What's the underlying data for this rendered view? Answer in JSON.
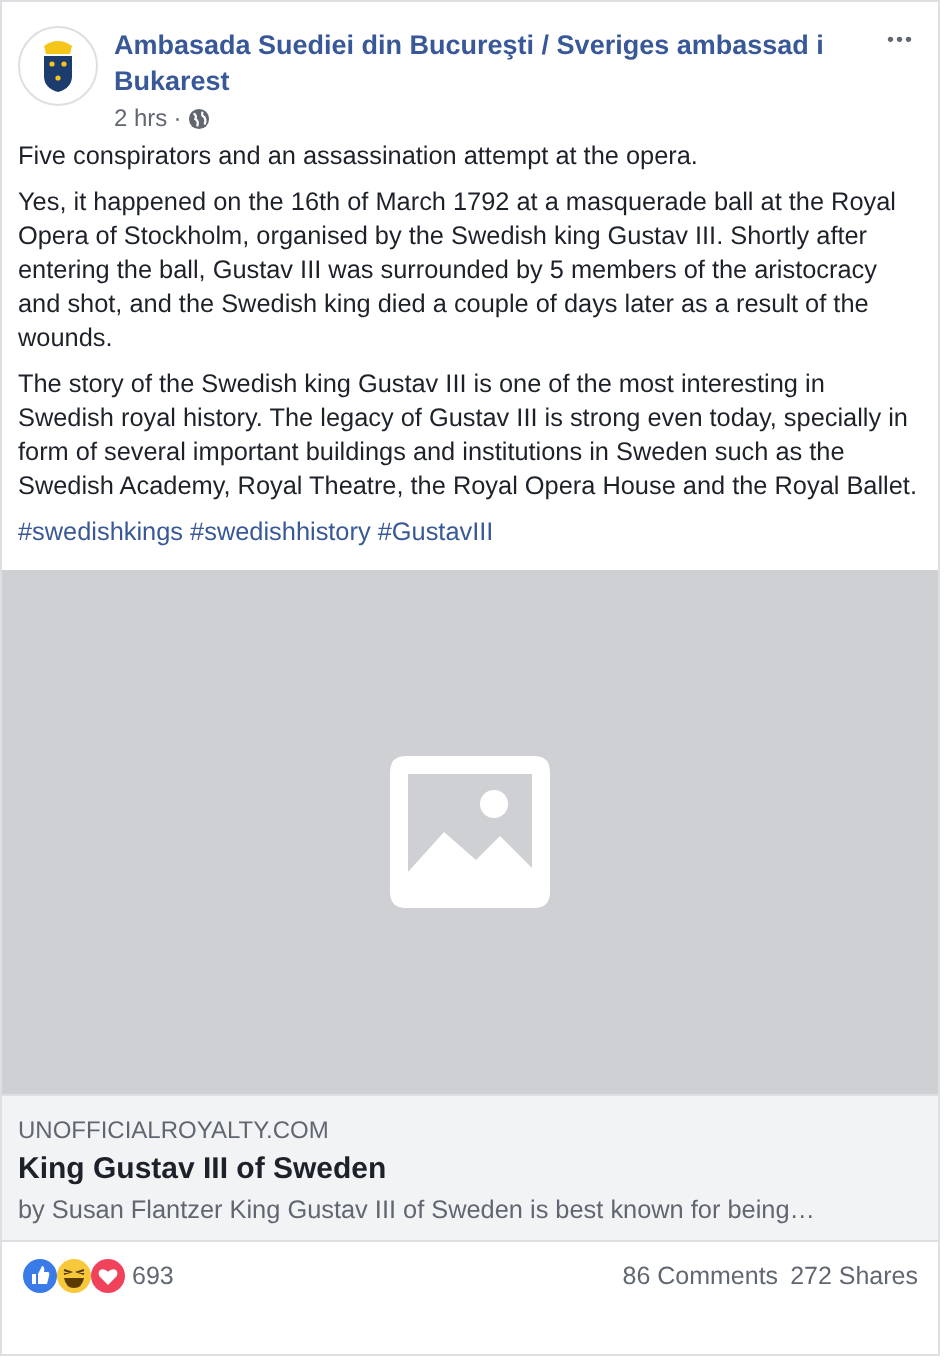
{
  "post": {
    "author": "Ambasada Suediei din Bucureşti / Sveriges ambassad i Bukarest",
    "time": "2 hrs",
    "separator": "·",
    "menu": "•••"
  },
  "paragraphs": [
    "Five conspirators and an assassination attempt at the opera.",
    "Yes, it happened on the 16th of March 1792 at a masquerade ball at the Royal Opera of Stockholm, organised by the Swedish king Gustav III. Shortly after entering the ball, Gustav III was surrounded by 5 members of the aristocracy and shot, and the Swedish king died a couple of days later as a result of the wounds.",
    "The story of the Swedish king Gustav III is one of the most interesting in Swedish royal history. The legacy of Gustav III is strong even today, specially in form of several important buildings and institutions in Sweden such as the Swedish Academy, Royal Theatre, the Royal Opera House and the Royal Ballet."
  ],
  "hashtags": [
    "#swedishkings",
    "#swedishhistory",
    "#GustavIII"
  ],
  "link_preview": {
    "domain": "UNOFFICIALROYALTY.COM",
    "title": "King Gustav III of Sweden",
    "description": "by Susan Flantzer King Gustav III of Sweden is best known for being…"
  },
  "footer": {
    "reaction_count": "693",
    "comments": "86 Comments",
    "shares": "272 Shares"
  }
}
